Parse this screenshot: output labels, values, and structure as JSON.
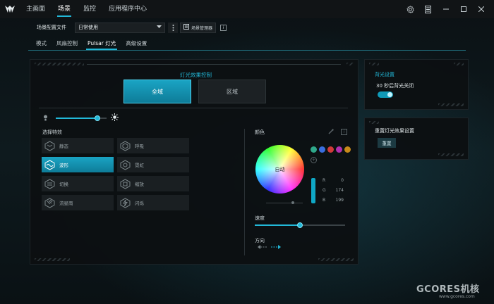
{
  "nav": {
    "items": [
      {
        "label": "主画面",
        "active": false
      },
      {
        "label": "场景",
        "active": true
      },
      {
        "label": "监控",
        "active": false
      },
      {
        "label": "应用程序中心",
        "active": false
      }
    ]
  },
  "window_controls": [
    "gear-icon",
    "notes-icon",
    "minimize-icon",
    "maximize-icon",
    "close-icon"
  ],
  "profile": {
    "label": "场景配置文件",
    "selected": "日常使用",
    "scene_manager_label": "场景管理器",
    "info_glyph": "i"
  },
  "tabs": [
    {
      "label": "模式",
      "active": false
    },
    {
      "label": "风扇控制",
      "active": false
    },
    {
      "label": "Pulsar 灯光",
      "active": true
    },
    {
      "label": "高级设置",
      "active": false
    }
  ],
  "lighting": {
    "title": "灯光效果控制",
    "mode_global": "全域",
    "mode_zone": "区域",
    "brightness": 0.82,
    "effects_label": "选择特效",
    "effects": [
      {
        "label": "静态",
        "icon": "static-effect-icon",
        "active": false
      },
      {
        "label": "呼吸",
        "icon": "breathing-effect-icon",
        "active": false
      },
      {
        "label": "波形",
        "icon": "wave-effect-icon",
        "active": true
      },
      {
        "label": "霓虹",
        "icon": "neon-effect-icon",
        "active": false
      },
      {
        "label": "切换",
        "icon": "switch-effect-icon",
        "active": false
      },
      {
        "label": "缩放",
        "icon": "zoom-effect-icon",
        "active": false
      },
      {
        "label": "流星雨",
        "icon": "meteor-effect-icon",
        "active": false
      },
      {
        "label": "闪烁",
        "icon": "flash-effect-icon",
        "active": false
      }
    ],
    "color_label": "颜色",
    "wheel_text": "自动",
    "swatches": [
      "#2fa88a",
      "#3a6ee0",
      "#d03a3a",
      "#b030b0",
      "#c88a1a"
    ],
    "rgb": [
      {
        "k": "R",
        "v": "0"
      },
      {
        "k": "G",
        "v": "174"
      },
      {
        "k": "B",
        "v": "199"
      }
    ],
    "speed_label": "速度",
    "speed": 0.5,
    "direction_label": "方向"
  },
  "backlight": {
    "title": "背光设置",
    "label": "30 秒后背光关闭",
    "enabled": true
  },
  "reset": {
    "title": "重置灯光效果设置",
    "button": "重置"
  },
  "watermark": {
    "brand": "GCORES机核",
    "url": "www.gcores.com"
  },
  "colors": {
    "accent": "#22b8d8",
    "panel": "#0c1012",
    "active_button": "#1aa4c4"
  }
}
